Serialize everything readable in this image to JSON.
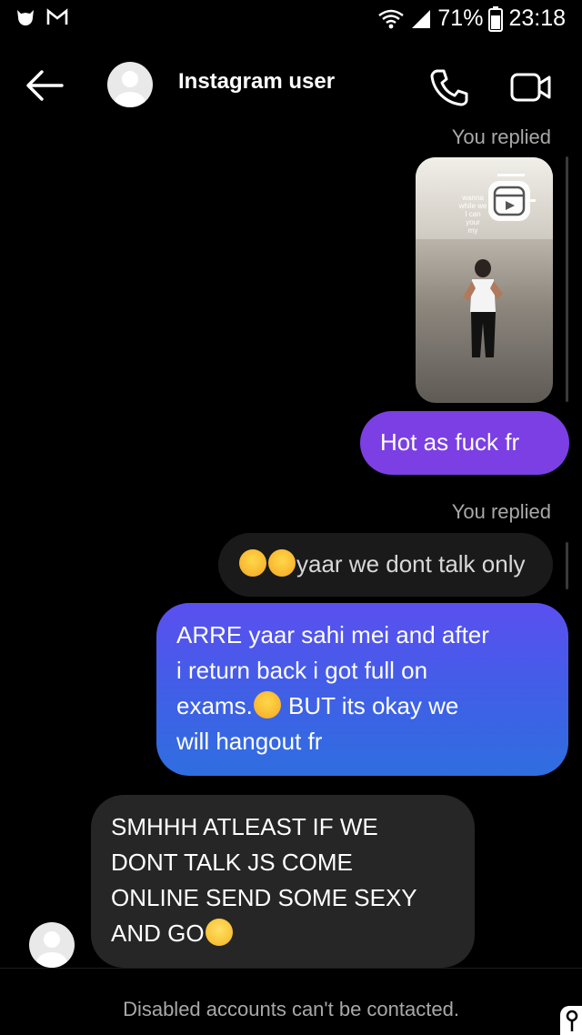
{
  "status_bar": {
    "battery": "71%",
    "time": "23:18",
    "left_icons": [
      "cat-icon",
      "gmail-icon"
    ],
    "right_icons": [
      "wifi-icon",
      "signal-icon",
      "battery-icon"
    ]
  },
  "header": {
    "contact_name": "Instagram user",
    "icons": [
      "back-arrow-icon",
      "avatar-icon",
      "phone-icon",
      "video-camera-icon"
    ]
  },
  "messages": [
    {
      "type": "meta",
      "text": "You replied"
    },
    {
      "type": "reel",
      "caption_lines": [
        "wanna",
        "while we",
        "I can",
        "your",
        "my"
      ]
    },
    {
      "type": "sent",
      "text": "Hot as fuck fr"
    },
    {
      "type": "meta",
      "text": "You replied"
    },
    {
      "type": "quote",
      "text": "yaar we dont talk only"
    },
    {
      "type": "sent",
      "lines": [
        "ARRE yaar sahi mei and after",
        "i return back i got full on",
        "exams.",
        " BUT its okay we",
        "will hangout fr"
      ]
    },
    {
      "type": "received",
      "lines": [
        "SMHHH ATLEAST IF WE",
        "DONT TALK JS COME",
        "ONLINE SEND SOME SEXY",
        "AND GO"
      ]
    }
  ],
  "footer": {
    "text": "Disabled accounts can't be contacted."
  },
  "colors": {
    "background": "#000000",
    "sent_purple": "#7b3fe4",
    "sent_blue": "#3f60e6",
    "received": "#262626",
    "meta_text": "#a8a8a8"
  }
}
